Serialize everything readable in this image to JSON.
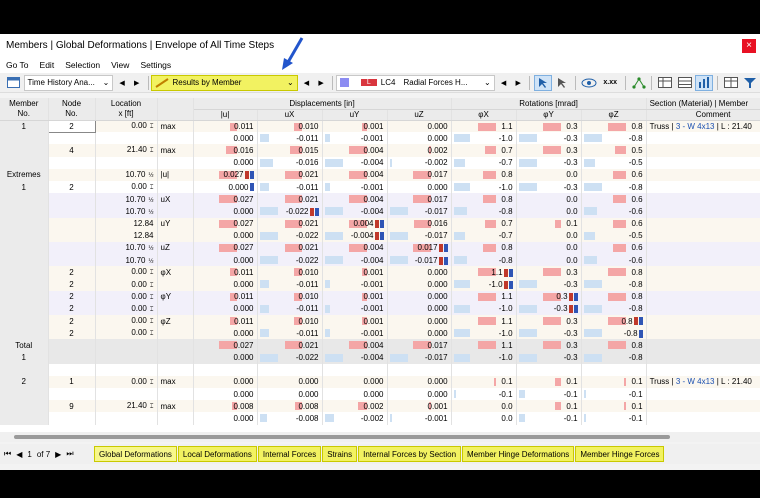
{
  "window": {
    "title": "Members | Global Deformations | Envelope of All Time Steps",
    "close_label": "×"
  },
  "menu": [
    "Go To",
    "Edit",
    "Selection",
    "View",
    "Settings"
  ],
  "toolbar": {
    "analysis_dropdown": "Time History Ana...",
    "results_dropdown": "Results by Member",
    "lc_badge": "L",
    "lc_label": "LC4",
    "lc_desc": "Radial Forces H...",
    "xxx_label": "x.xx"
  },
  "colors": {
    "accent_yellow": "#f2f261",
    "positive_bar": "#f4a6a6",
    "negative_bar": "#cde0f3",
    "lc_red": "#d9363e",
    "lc_violet": "#8c8cf2"
  },
  "headers": {
    "member": "Member\nNo.",
    "node": "Node\nNo.",
    "location": "Location\nx [ft]",
    "displacements": "Displacements [in]",
    "rotations": "Rotations [mrad]",
    "section": "Section (Material) | Member",
    "comment": "Comment",
    "u": "|u|",
    "ux": "uX",
    "uy": "uY",
    "uz": "uZ",
    "px": "φX",
    "py": "φY",
    "pz": "φZ"
  },
  "rows": [
    {
      "t": "a",
      "m": "1",
      "n": "2",
      "loc": "0.00",
      "bx": true,
      "q": "max",
      "u": "0.011",
      "ux": "0.010",
      "uy": "0.001",
      "uz": "0.000",
      "px": "1.1",
      "py": "0.3",
      "pz": "0.8",
      "sec": "Truss | 3 - W 4x13 | L : 21.40"
    },
    {
      "t": "b",
      "m": "",
      "n": "",
      "loc": "",
      "q": "",
      "u": "0.000",
      "ux": "-0.011",
      "uy": "-0.001",
      "uz": "0.000",
      "px": "-1.0",
      "py": "-0.3",
      "pz": "-0.8",
      "sec": ""
    },
    {
      "t": "a",
      "m": "",
      "n": "4",
      "loc": "21.40",
      "bx": true,
      "q": "max",
      "u": "0.016",
      "ux": "0.015",
      "uy": "0.004",
      "uz": "0.002",
      "px": "0.7",
      "py": "0.3",
      "pz": "0.5",
      "sec": ""
    },
    {
      "t": "b",
      "m": "",
      "n": "",
      "loc": "",
      "q": "",
      "u": "0.000",
      "ux": "-0.016",
      "uy": "-0.004",
      "uz": "-0.002",
      "px": "-0.7",
      "py": "-0.3",
      "pz": "-0.5",
      "sec": ""
    },
    {
      "t": "a",
      "m": "Extremes",
      "n": "",
      "loc": "10.70",
      "half": true,
      "q": "|u|",
      "u": "0.027",
      "um": "rb",
      "ux": "0.021",
      "uy": "0.004",
      "uz": "0.017",
      "px": "0.8",
      "py": "0.0",
      "pz": "0.6",
      "sec": ""
    },
    {
      "t": "b",
      "m": "1",
      "n": "2",
      "loc": "0.00",
      "bx": true,
      "q": "",
      "u": "0.000",
      "um": "b",
      "ux": "-0.011",
      "uy": "-0.001",
      "uz": "0.000",
      "px": "-1.0",
      "py": "-0.3",
      "pz": "-0.8",
      "sec": ""
    },
    {
      "t": "c",
      "m": "",
      "n": "",
      "loc": "10.70",
      "half": true,
      "q": "uX",
      "u": "0.027",
      "ux": "0.021",
      "uy": "0.004",
      "uz": "0.017",
      "px": "0.8",
      "py": "0.0",
      "pz": "0.6",
      "sec": ""
    },
    {
      "t": "c",
      "m": "",
      "n": "",
      "loc": "10.70",
      "half": true,
      "q": "",
      "u": "0.000",
      "ux": "-0.022",
      "uxm": "rb",
      "uy": "-0.004",
      "uz": "-0.017",
      "px": "-0.8",
      "py": "0.0",
      "pz": "-0.6",
      "sec": ""
    },
    {
      "t": "a",
      "m": "",
      "n": "",
      "loc": "12.84",
      "q": "uY",
      "u": "0.027",
      "ux": "0.021",
      "uy": "0.004",
      "uym": "rb",
      "uz": "0.016",
      "px": "0.7",
      "py": "0.1",
      "pz": "0.6",
      "sec": ""
    },
    {
      "t": "a",
      "m": "",
      "n": "",
      "loc": "12.84",
      "q": "",
      "u": "0.000",
      "ux": "-0.022",
      "uy": "-0.004",
      "uym": "rb",
      "uz": "-0.017",
      "px": "-0.7",
      "py": "0.0",
      "pz": "-0.5",
      "sec": ""
    },
    {
      "t": "c",
      "m": "",
      "n": "",
      "loc": "10.70",
      "half": true,
      "q": "uZ",
      "u": "0.027",
      "ux": "0.021",
      "uy": "0.004",
      "uz": "0.017",
      "uzm": "rb",
      "px": "0.8",
      "py": "0.0",
      "pz": "0.6",
      "sec": ""
    },
    {
      "t": "c",
      "m": "",
      "n": "",
      "loc": "10.70",
      "half": true,
      "q": "",
      "u": "0.000",
      "ux": "-0.022",
      "uy": "-0.004",
      "uz": "-0.017",
      "uzm": "rb",
      "px": "-0.8",
      "py": "0.0",
      "pz": "-0.6",
      "sec": ""
    },
    {
      "t": "a",
      "m": "",
      "n": "2",
      "loc": "0.00",
      "bx": true,
      "q": "φX",
      "u": "0.011",
      "ux": "0.010",
      "uy": "0.001",
      "uz": "0.000",
      "px": "1.1",
      "pxm": "rb",
      "py": "0.3",
      "pz": "0.8",
      "sec": ""
    },
    {
      "t": "a",
      "m": "",
      "n": "2",
      "loc": "0.00",
      "bx": true,
      "q": "",
      "u": "0.000",
      "ux": "-0.011",
      "uy": "-0.001",
      "uz": "0.000",
      "px": "-1.0",
      "pxm": "rb",
      "py": "-0.3",
      "pz": "-0.8",
      "sec": ""
    },
    {
      "t": "c",
      "m": "",
      "n": "2",
      "loc": "0.00",
      "bx": true,
      "q": "φY",
      "u": "0.011",
      "ux": "0.010",
      "uy": "0.001",
      "uz": "0.000",
      "px": "1.1",
      "py": "0.3",
      "pym": "rb",
      "pz": "0.8",
      "sec": ""
    },
    {
      "t": "c",
      "m": "",
      "n": "2",
      "loc": "0.00",
      "bx": true,
      "q": "",
      "u": "0.000",
      "ux": "-0.011",
      "uy": "-0.001",
      "uz": "0.000",
      "px": "-1.0",
      "py": "-0.3",
      "pym": "rb",
      "pz": "-0.8",
      "sec": ""
    },
    {
      "t": "a",
      "m": "",
      "n": "2",
      "loc": "0.00",
      "bx": true,
      "q": "φZ",
      "u": "0.011",
      "ux": "0.010",
      "uy": "0.001",
      "uz": "0.000",
      "px": "1.1",
      "py": "0.3",
      "pz": "0.8",
      "pzm": "rb",
      "sec": ""
    },
    {
      "t": "a",
      "m": "",
      "n": "2",
      "loc": "0.00",
      "bx": true,
      "q": "",
      "u": "0.000",
      "ux": "-0.011",
      "uy": "-0.001",
      "uz": "0.000",
      "px": "-1.0",
      "py": "-0.3",
      "pz": "-0.8",
      "pzm": "b",
      "sec": ""
    },
    {
      "t": "t",
      "m": "Total",
      "n": "",
      "loc": "",
      "q": "",
      "u": "0.027",
      "ux": "0.021",
      "uy": "0.004",
      "uz": "0.017",
      "px": "1.1",
      "py": "0.3",
      "pz": "0.8",
      "sec": ""
    },
    {
      "t": "t",
      "m": "1",
      "n": "",
      "loc": "",
      "q": "",
      "u": "0.000",
      "ux": "-0.022",
      "uy": "-0.004",
      "uz": "-0.017",
      "px": "-1.0",
      "py": "-0.3",
      "pz": "-0.8",
      "sec": ""
    },
    {
      "t": "gap"
    },
    {
      "t": "a",
      "m": "2",
      "n": "1",
      "loc": "0.00",
      "bx": true,
      "q": "max",
      "u": "0.000",
      "ux": "0.000",
      "uy": "0.000",
      "uz": "0.000",
      "px": "0.1",
      "py": "0.1",
      "pz": "0.1",
      "sec": "Truss | 3 - W 4x13 | L : 21.40"
    },
    {
      "t": "b",
      "m": "",
      "n": "",
      "loc": "",
      "q": "",
      "u": "0.000",
      "ux": "0.000",
      "uy": "0.000",
      "uz": "0.000",
      "px": "-0.1",
      "py": "-0.1",
      "pz": "-0.1",
      "sec": ""
    },
    {
      "t": "a",
      "m": "",
      "n": "9",
      "loc": "21.40",
      "bx": true,
      "q": "max",
      "u": "0.008",
      "ux": "0.008",
      "uy": "0.002",
      "uz": "0.001",
      "px": "0.0",
      "py": "0.1",
      "pz": "0.1",
      "sec": ""
    },
    {
      "t": "b",
      "m": "",
      "n": "",
      "loc": "",
      "q": "",
      "u": "0.000",
      "ux": "-0.008",
      "uy": "-0.002",
      "uz": "-0.001",
      "px": "0.0",
      "py": "-0.1",
      "pz": "-0.1",
      "sec": ""
    }
  ],
  "pager": {
    "current": "1",
    "of_label": "of 7"
  },
  "tabs": [
    "Global Deformations",
    "Local Deformations",
    "Internal Forces",
    "Strains",
    "Internal Forces by Section",
    "Member Hinge Deformations",
    "Member Hinge Forces"
  ],
  "active_tab": 0
}
